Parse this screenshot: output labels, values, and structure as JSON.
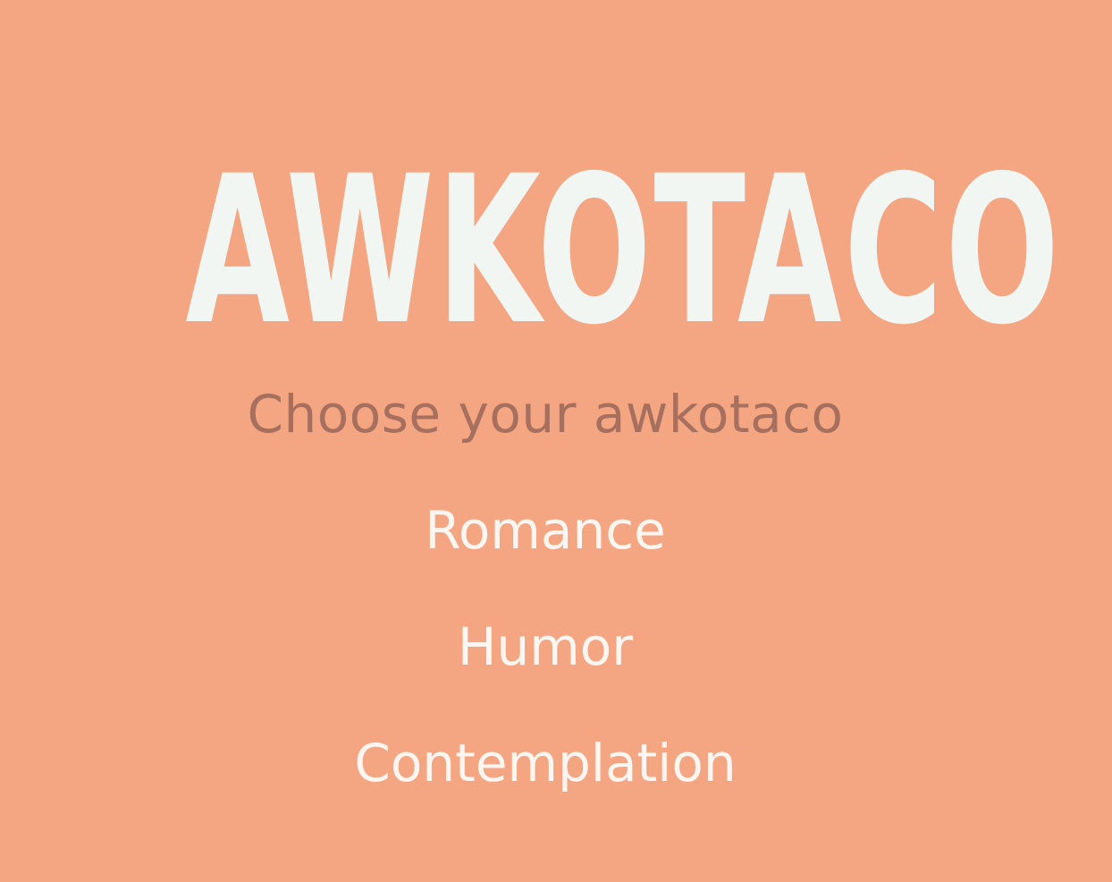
{
  "logo": {
    "text": "AWKOTACO"
  },
  "subtitle": "Choose your awkotaco",
  "options": [
    {
      "label": "Romance"
    },
    {
      "label": "Humor"
    },
    {
      "label": "Contemplation"
    }
  ],
  "colors": {
    "background": "#f4a582",
    "logo": "#f1f6f2",
    "subtitle": "#a66f5e",
    "option": "#fff6f1"
  }
}
